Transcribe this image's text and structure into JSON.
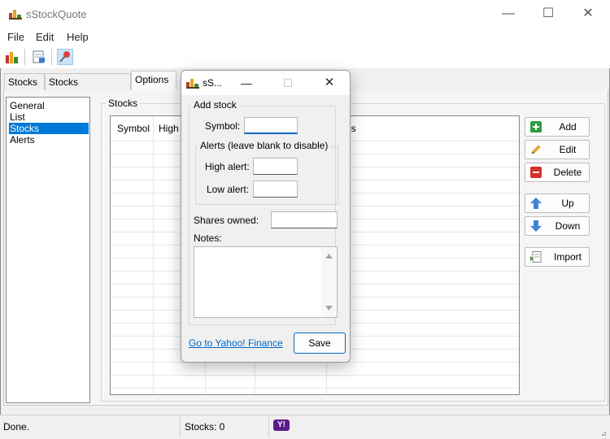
{
  "window": {
    "title": "sStockQuote",
    "controls": {
      "minimize": "—",
      "maximize": "☐",
      "close": "✕"
    }
  },
  "menu": [
    "File",
    "Edit",
    "Help"
  ],
  "toolbar": {
    "icons": [
      "chart-icon",
      "export-icon",
      "pin-icon"
    ],
    "pressed": "pin-icon"
  },
  "tabs": [
    {
      "label": "Stocks",
      "active": false
    },
    {
      "label": "Stocks (extended)",
      "active": false
    },
    {
      "label": "Options",
      "active": true
    }
  ],
  "options_nav": [
    {
      "label": "General",
      "selected": false
    },
    {
      "label": "List",
      "selected": false
    },
    {
      "label": "Stocks",
      "selected": true
    },
    {
      "label": "Alerts",
      "selected": false
    }
  ],
  "stocks_group": {
    "label": "Stocks",
    "columns": [
      "Symbol",
      "High a",
      "es"
    ]
  },
  "side_buttons": [
    {
      "label": "Add",
      "icon": "plus-icon"
    },
    {
      "label": "Edit",
      "icon": "pencil-icon"
    },
    {
      "label": "Delete",
      "icon": "minus-icon"
    },
    {
      "label": "Up",
      "icon": "arrow-up-icon"
    },
    {
      "label": "Down",
      "icon": "arrow-down-icon"
    },
    {
      "label": "Import",
      "icon": "import-icon"
    }
  ],
  "dialog": {
    "title": "sS...",
    "controls": {
      "minimize": "—",
      "maximize": "☐",
      "close": "✕"
    },
    "add_stock_label": "Add stock",
    "symbol_label": "Symbol:",
    "symbol_value": "",
    "alerts_label": "Alerts (leave blank to disable)",
    "high_alert_label": "High alert:",
    "high_alert_value": "",
    "low_alert_label": "Low alert:",
    "low_alert_value": "",
    "shares_label": "Shares owned:",
    "shares_value": "",
    "notes_label": "Notes:",
    "notes_value": "",
    "link": "Go to Yahoo! Finance",
    "save": "Save"
  },
  "status": {
    "text": "Done.",
    "stocks_count": "Stocks: 0",
    "yahoo_logo": "Y!"
  },
  "colors": {
    "selection": "#0078d7",
    "link": "#0066cc",
    "focus": "#0067c0"
  }
}
